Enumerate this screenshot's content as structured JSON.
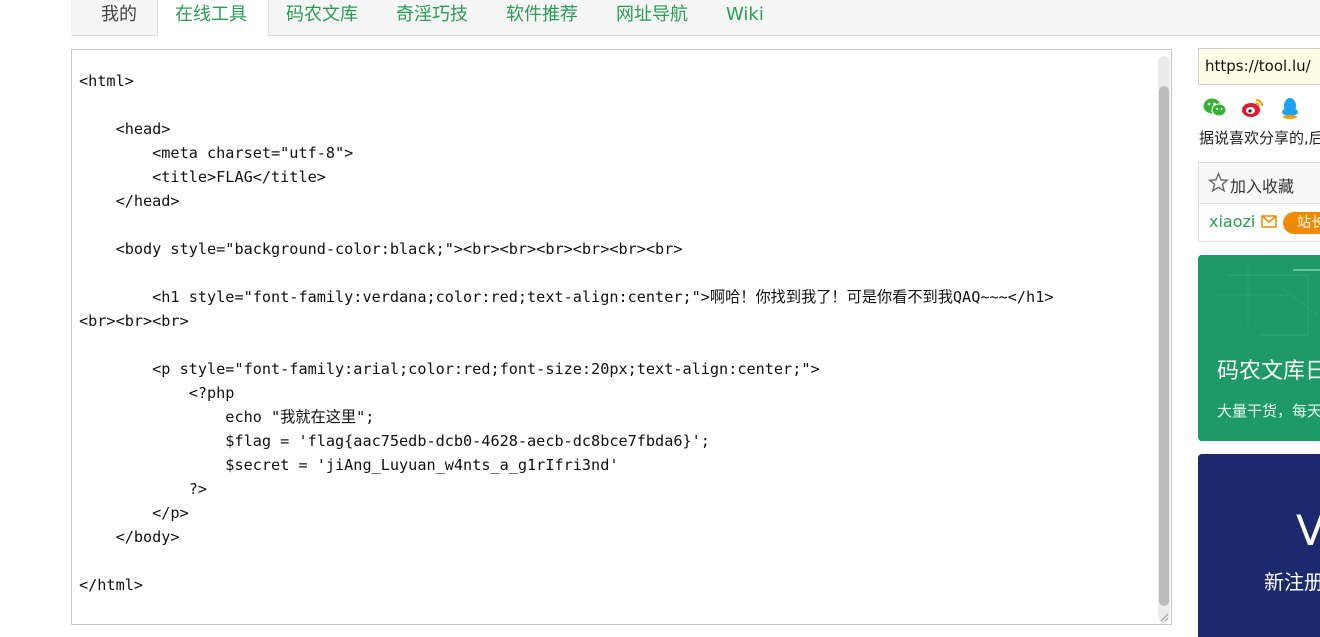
{
  "nav": {
    "tabs": [
      {
        "label": "我的"
      },
      {
        "label": "在线工具"
      },
      {
        "label": "码农文库"
      },
      {
        "label": "奇淫巧技"
      },
      {
        "label": "软件推荐"
      },
      {
        "label": "网址导航"
      },
      {
        "label": "Wiki"
      }
    ],
    "active_tab": "在线工具",
    "accent_color": "#2a9d55"
  },
  "code": {
    "lines": [
      "<html>",
      "",
      "    <head>",
      "        <meta charset=\"utf-8\">",
      "        <title>FLAG</title>",
      "    </head>",
      "",
      "    <body style=\"background-color:black;\"><br><br><br><br><br><br>",
      "",
      "        <h1 style=\"font-family:verdana;color:red;text-align:center;\">啊哈！你找到我了！可是你看不到我QAQ~~~</h1>",
      "<br><br><br>",
      "",
      "        <p style=\"font-family:arial;color:red;font-size:20px;text-align:center;\">",
      "            <?php",
      "                echo \"我就在这里\";",
      "                $flag = 'flag{aac75edb-dcb0-4628-aecb-dc8bce7fbda6}';",
      "                $secret = 'jiAng_Luyuan_w4nts_a_g1rIfri3nd'",
      "            ?>",
      "        </p>",
      "    </body>",
      "",
      "</html>"
    ]
  },
  "sidebar": {
    "url": "https://tool.lu/",
    "share_icons": [
      "wechat-icon",
      "weibo-icon",
      "qq-icon"
    ],
    "share_text": "据说喜欢分享的,后",
    "favorite_label": "加入收藏",
    "user_name": "xiaozi",
    "badge_label": "站长",
    "badge_color": "#f08a00",
    "banner1_title": "码农文库日",
    "banner1_subtitle": "大量干货，每天",
    "banner2_big": "V",
    "banner2_subtitle": "新注册"
  }
}
